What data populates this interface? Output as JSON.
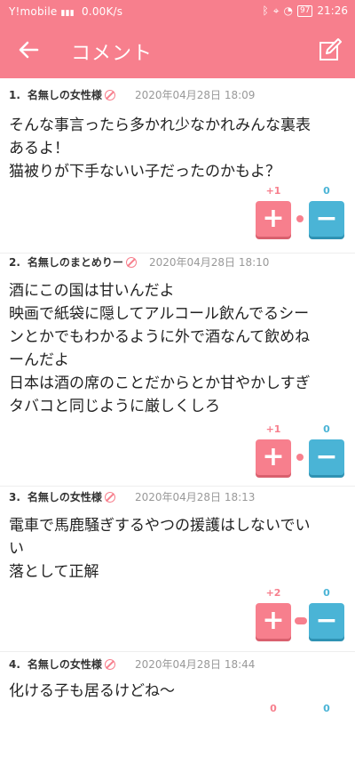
{
  "status": {
    "carrier": "Y!mobile",
    "speed": "0.00K/s",
    "battery": "97",
    "time": "21:26"
  },
  "appbar": {
    "title": "コメント"
  },
  "comments": [
    {
      "num": "1.",
      "name": "名無しの女性様",
      "date": "2020年04月28日 18:09",
      "text": "そんな事言ったら多かれ少なかれみんな裏表\nあるよ！\n猫被りが下手ないい子だったのかもよ？",
      "plus": "+1",
      "minus": "0"
    },
    {
      "num": "2.",
      "name": "名無しのまとめりー",
      "date": "2020年04月28日 18:10",
      "text": "酒にこの国は甘いんだよ\n映画で紙袋に隠してアルコール飲んでるシー\nンとかでもわかるように外で酒なんて飲めね\nーんだよ\n日本は酒の席のことだからとか甘やかしすぎ\nタバコと同じように厳しくしろ",
      "plus": "+1",
      "minus": "0"
    },
    {
      "num": "3.",
      "name": "名無しの女性様",
      "date": "2020年04月28日 18:13",
      "text": "電車で馬鹿騒ぎするやつの援護はしないでい\nい\n落として正解",
      "plus": "+2",
      "minus": "0"
    },
    {
      "num": "4.",
      "name": "名無しの女性様",
      "date": "2020年04月28日 18:44",
      "text": "化ける子も居るけどね〜",
      "plus": "0",
      "minus": "0"
    }
  ],
  "icons": {
    "back": "arrow-left-icon",
    "edit": "edit-icon",
    "ban": "block-icon"
  },
  "colors": {
    "accent": "#f77f8d",
    "minus": "#4ab4d6"
  }
}
